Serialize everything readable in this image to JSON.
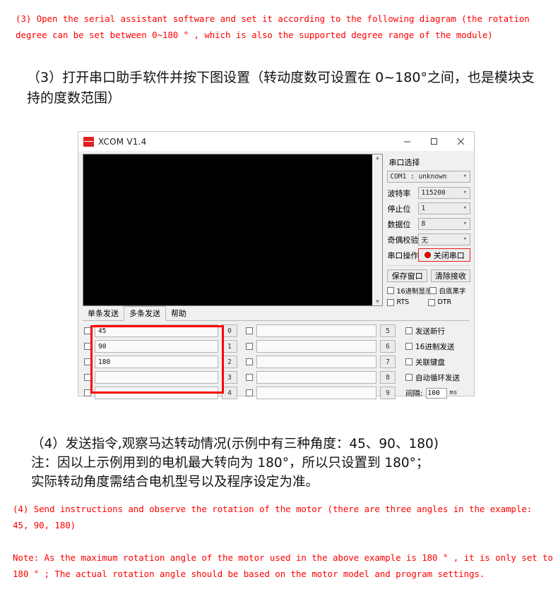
{
  "instructions": {
    "en_top": "(3) Open the serial assistant software and set it according to the following diagram (the rotation degree can be set between 0~180 ° , which is also the supported degree range of the module)",
    "cn_top": "（3）打开串口助手软件并按下图设置（转动度数可设置在 0~180°之间，也是模块支持的度数范围）",
    "cn_bottom": "（4）发送指令,观察马达转动情况(示例中有三种角度：45、90、180)\n注：因以上示例用到的电机最大转向为 180°，所以只设置到 180°；\n实际转动角度需结合电机型号以及程序设定为准。",
    "en_bottom_1": "(4) Send instructions and observe the rotation of the motor (there are three angles in the example: 45, 90, 180)",
    "en_bottom_2": "Note: As the maximum rotation angle of the motor used in the above example is 180 ° , it is only set to 180 ° ; The actual rotation angle should be based on the motor model and program settings."
  },
  "xcom": {
    "title": "XCOM V1.4",
    "logo_icon": "alientek-logo-icon",
    "window_controls": {
      "minimize": "minimize-icon",
      "maximize": "maximize-icon",
      "close": "close-icon"
    },
    "terminal": {
      "content": "",
      "scroll_up": "▲",
      "scroll_down": "▼"
    },
    "settings": {
      "section_title": "串口选择",
      "port_value": "COM1 : unknown",
      "fields": [
        {
          "label": "波特率",
          "value": "115200"
        },
        {
          "label": "停止位",
          "value": "1"
        },
        {
          "label": "数据位",
          "value": "8"
        },
        {
          "label": "奇偶校验",
          "value": "无"
        }
      ],
      "port_action_label": "串口操作",
      "port_action_button": "关闭串口",
      "buttons": [
        {
          "label": "保存窗口"
        },
        {
          "label": "清除接收"
        }
      ],
      "checkboxes": [
        {
          "label": "16进制显示",
          "checked": false
        },
        {
          "label": "白底黑字",
          "checked": false
        },
        {
          "label": "RTS",
          "checked": false
        },
        {
          "label": "DTR",
          "checked": false
        }
      ]
    },
    "tabs": [
      {
        "label": "单条发送",
        "active": false
      },
      {
        "label": "多条发送",
        "active": true
      },
      {
        "label": "帮助",
        "active": false
      }
    ],
    "multisend": {
      "column_left": [
        {
          "index": "0",
          "value": "45",
          "checked": false
        },
        {
          "index": "1",
          "value": "90",
          "checked": false
        },
        {
          "index": "2",
          "value": "180",
          "checked": false
        },
        {
          "index": "3",
          "value": "",
          "checked": false
        },
        {
          "index": "4",
          "value": "",
          "checked": false
        }
      ],
      "column_right": [
        {
          "index": "5",
          "value": "",
          "checked": false
        },
        {
          "index": "6",
          "value": "",
          "checked": false
        },
        {
          "index": "7",
          "value": "",
          "checked": false
        },
        {
          "index": "8",
          "value": "",
          "checked": false
        },
        {
          "index": "9",
          "value": "",
          "checked": false
        }
      ],
      "options": [
        {
          "label": "发送新行",
          "checked": false
        },
        {
          "label": "16进制发送",
          "checked": false
        },
        {
          "label": "关联键盘",
          "checked": false
        },
        {
          "label": "自动循环发送",
          "checked": false
        }
      ],
      "interval_label": "间隔:",
      "interval_value": "100",
      "interval_unit": "ms"
    }
  },
  "colors": {
    "annotation_red": "#ff0000",
    "highlight_box": "#fe0000",
    "accent": "#e02020"
  }
}
